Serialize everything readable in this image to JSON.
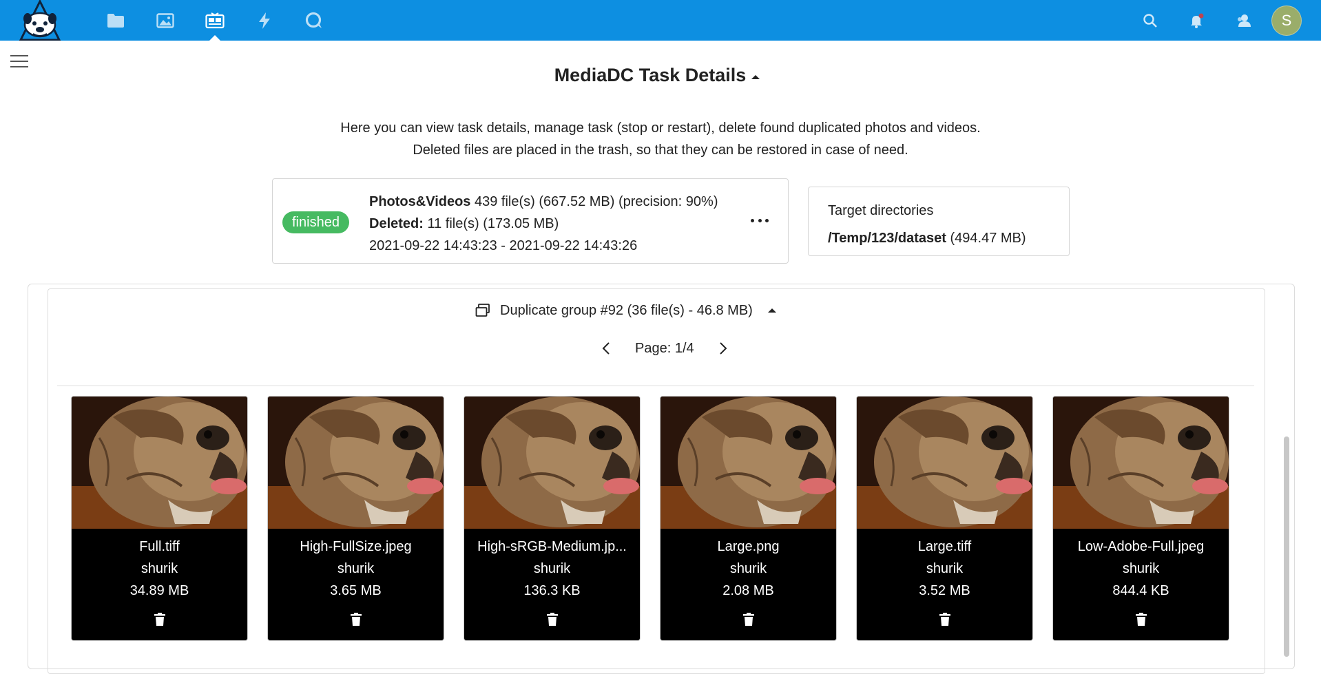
{
  "header": {
    "nav_apps": [
      "files-icon",
      "photos-icon",
      "mediadc-icon",
      "activity-icon",
      "talk-icon"
    ],
    "active_app": "mediadc-icon",
    "right_icons": [
      "search-icon",
      "notifications-icon",
      "contacts-icon"
    ],
    "avatar_letter": "S",
    "avatar_color": "#9aad6a",
    "brand_color": "#0d8fe1"
  },
  "page": {
    "title": "MediaDC Task Details",
    "description_line1": "Here you can view task details, manage task (stop or restart), delete found duplicated photos and videos.",
    "description_line2": "Deleted files are placed in the trash, so that they can be restored in case of need."
  },
  "task": {
    "status": "finished",
    "status_color": "#46ba61",
    "type_label": "Photos&Videos",
    "type_stats": "439 file(s) (667.52 MB) (precision: 90%)",
    "deleted_label": "Deleted:",
    "deleted_stats": "11 file(s) (173.05 MB)",
    "time_range": "2021-09-22 14:43:23 - 2021-09-22 14:43:26"
  },
  "target": {
    "heading": "Target directories",
    "path": "/Temp/123/dataset",
    "size": "(494.47 MB)"
  },
  "group": {
    "title": "Duplicate group #92 (36 file(s) - 46.8 MB)",
    "page_label": "Page: 1/4",
    "files": [
      {
        "name": "Full.tiff",
        "owner": "shurik",
        "size": "34.89 MB"
      },
      {
        "name": "High-FullSize.jpeg",
        "owner": "shurik",
        "size": "3.65 MB"
      },
      {
        "name": "High-sRGB-Medium.jp...",
        "owner": "shurik",
        "size": "136.3 KB"
      },
      {
        "name": "Large.png",
        "owner": "shurik",
        "size": "2.08 MB"
      },
      {
        "name": "Large.tiff",
        "owner": "shurik",
        "size": "3.52 MB"
      },
      {
        "name": "Low-Adobe-Full.jpeg",
        "owner": "shurik",
        "size": "844.4 KB"
      }
    ]
  }
}
